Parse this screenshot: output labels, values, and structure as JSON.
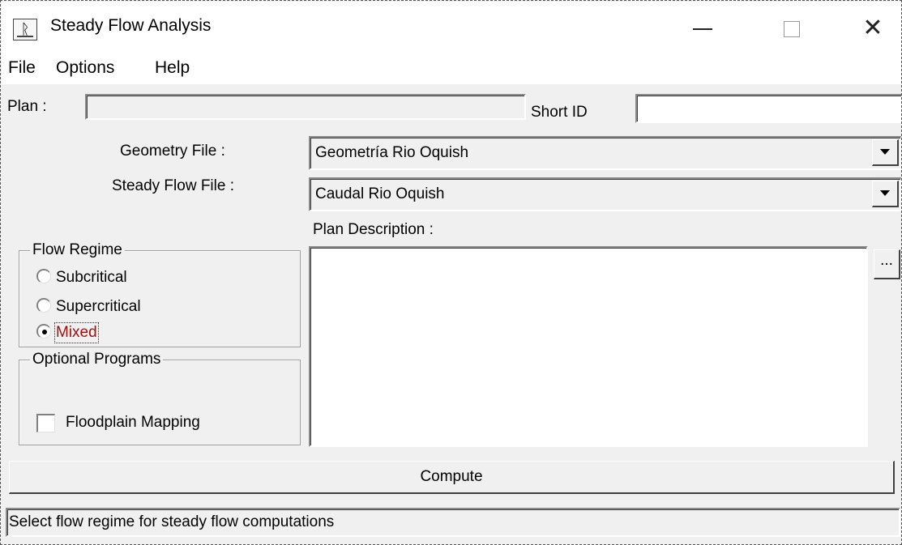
{
  "window": {
    "title": "Steady Flow Analysis",
    "icon": "app-runner-icon",
    "controls": {
      "minimize": "minimize-icon",
      "maximize": "maximize-icon",
      "close": "close-icon"
    }
  },
  "menu": {
    "items": [
      "File",
      "Options",
      "Help"
    ]
  },
  "plan": {
    "label": "Plan :",
    "value": "",
    "short_id_label": "Short ID",
    "short_id_value": ""
  },
  "geometry": {
    "label": "Geometry File :",
    "selected": "Geometría Rio Oquish"
  },
  "steady_flow": {
    "label": "Steady Flow File :",
    "selected": "Caudal Rio Oquish"
  },
  "description": {
    "label": "Plan Description :",
    "value": "",
    "more_button": "..."
  },
  "flow_regime": {
    "title": "Flow Regime",
    "options": [
      {
        "label": "Subcritical",
        "checked": false
      },
      {
        "label": "Supercritical",
        "checked": false
      },
      {
        "label": "Mixed",
        "checked": true
      }
    ],
    "selected_color": "#a01010"
  },
  "optional_programs": {
    "title": "Optional Programs",
    "floodplain_label": "Floodplain Mapping",
    "floodplain_checked": false
  },
  "compute": {
    "label": "Compute"
  },
  "status": {
    "text": "Select flow regime for steady flow computations"
  }
}
